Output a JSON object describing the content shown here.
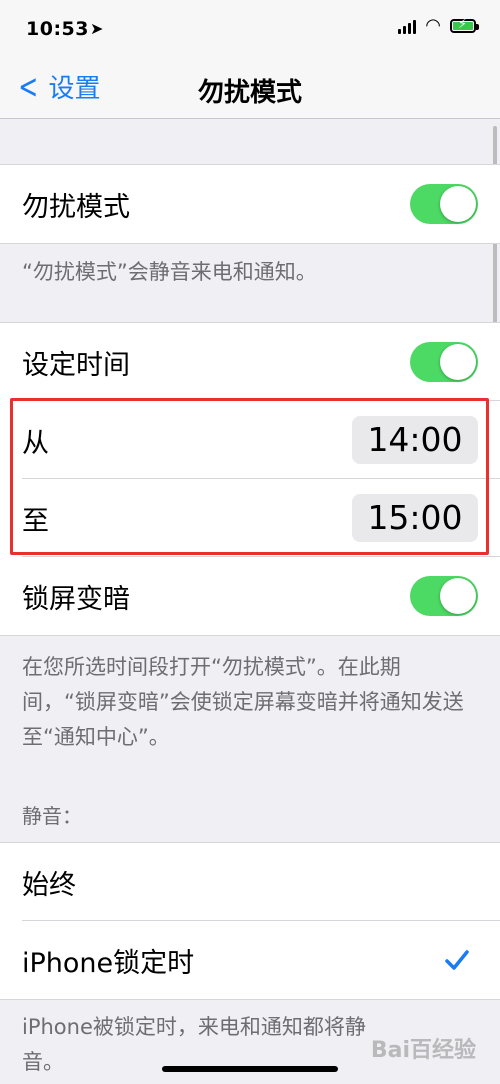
{
  "status_bar": {
    "time": "10:53",
    "location_icon": "location-arrow-icon",
    "wifi_icon": "wifi-icon",
    "battery_icon": "battery-charging-icon"
  },
  "nav": {
    "back_label": "设置",
    "title": "勿扰模式"
  },
  "dnd": {
    "label": "勿扰模式",
    "enabled": true,
    "note": "“勿扰模式”会静音来电和通知。"
  },
  "schedule": {
    "label": "设定时间",
    "enabled": true,
    "from_label": "从",
    "from_value": "14:00",
    "to_label": "至",
    "to_value": "15:00"
  },
  "dim_lock": {
    "label": "锁屏变暗",
    "enabled": true,
    "note": "在您所选时间段打开“勿扰模式”。在此期间，“锁屏变暗”会使锁定屏幕变暗并将通知发送至“通知中心”。"
  },
  "silence": {
    "header": "静音：",
    "options": [
      {
        "label": "始终",
        "selected": false
      },
      {
        "label": "iPhone锁定时",
        "selected": true
      }
    ],
    "note": "iPhone被锁定时，来电和通知都将静音。"
  },
  "watermark": "Bai百经验",
  "colors": {
    "accent": "#1a7cf5",
    "toggle_on": "#4cd964",
    "highlight": "#e83030"
  }
}
